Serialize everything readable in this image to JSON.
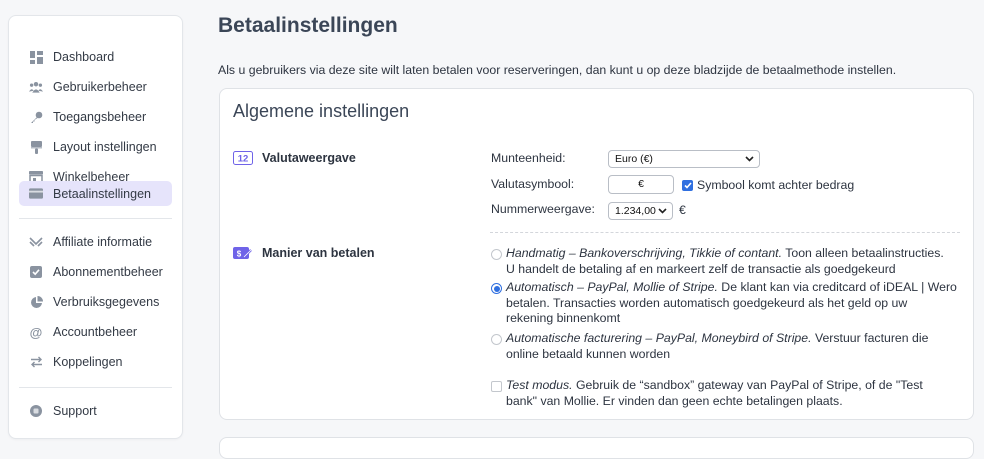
{
  "sidebar": {
    "items": [
      {
        "label": "Dashboard",
        "icon": "dashboard-icon"
      },
      {
        "label": "Gebruikerbeheer",
        "icon": "users-icon"
      },
      {
        "label": "Toegangsbeheer",
        "icon": "key-icon"
      },
      {
        "label": "Layout instellingen",
        "icon": "brush-icon"
      },
      {
        "label": "Winkelbeheer",
        "icon": "store-icon"
      },
      {
        "label": "Betaalinstellingen",
        "icon": "credit-card-icon",
        "active": true
      },
      {
        "label": "Affiliate informatie",
        "icon": "affiliate-icon"
      },
      {
        "label": "Abonnementbeheer",
        "icon": "subscription-icon"
      },
      {
        "label": "Verbruiksgegevens",
        "icon": "pie-chart-icon"
      },
      {
        "label": "Accountbeheer",
        "icon": "at-icon"
      },
      {
        "label": "Koppelingen",
        "icon": "arrows-icon"
      },
      {
        "label": "Support",
        "icon": "support-icon"
      }
    ]
  },
  "page": {
    "title": "Betaalinstellingen",
    "intro": "Als u gebruikers via deze site wilt laten betalen voor reserveringen, dan kunt u op deze bladzijde de betaalmethode instellen."
  },
  "general": {
    "title": "Algemene instellingen",
    "currency_section": {
      "badge": "12",
      "label": "Valutaweergave",
      "currency_label": "Munteenheid:",
      "currency_value": "Euro (€)",
      "symbol_label": "Valutasymbool:",
      "symbol_value": "€",
      "symbol_after_label": "Symbool komt achter bedrag",
      "symbol_after_checked": true,
      "number_label": "Nummerweergave:",
      "number_value": "1.234,00",
      "number_suffix": "€"
    },
    "payment_section": {
      "label": "Manier van betalen",
      "options": [
        {
          "title": "Handmatig – Bankoverschrijving, Tikkie of contant.",
          "desc_line1": " Toon alleen betaalinstructies.",
          "desc_line2": "U handelt de betaling af en markeert zelf de transactie als goedgekeurd",
          "checked": false
        },
        {
          "title": "Automatisch – PayPal, Mollie of Stripe.",
          "desc_line1": " De klant kan via creditcard of iDEAL | Wero",
          "desc_line2": "betalen. Transacties worden automatisch goedgekeurd als het geld op uw",
          "desc_line3": "rekening binnenkomt",
          "checked": true
        },
        {
          "title": "Automatische facturering – PayPal, Moneybird of Stripe.",
          "desc_line1": " Verstuur facturen die",
          "desc_line2": "online betaald kunnen worden",
          "checked": false
        }
      ],
      "test_mode": {
        "title": "Test modus.",
        "desc_line1": " Gebruik de “sandbox” gateway van PayPal of Stripe, of de \"Test",
        "desc_line2": "bank\" van Mollie. Er vinden dan geen echte betalingen plaats.",
        "checked": false
      }
    }
  },
  "colors": {
    "accent": "#2f6fe0",
    "active_bg": "#e6e4fb",
    "section_icon": "#6f63e8"
  }
}
